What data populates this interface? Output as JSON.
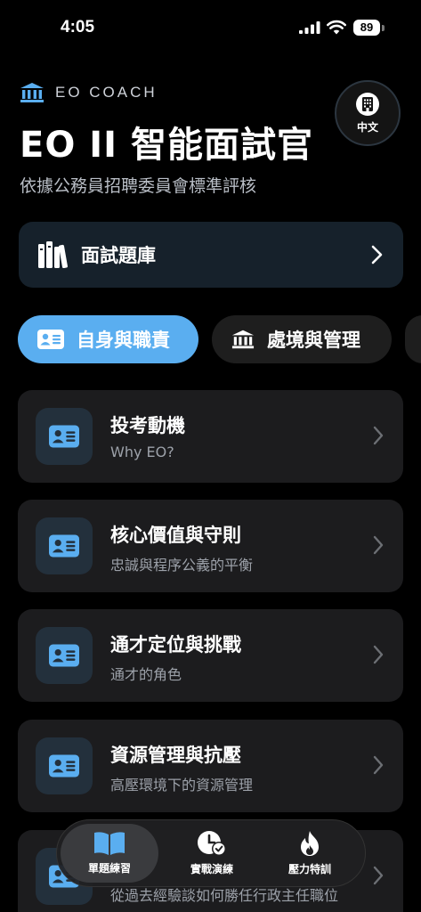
{
  "status_bar": {
    "time": "4:05",
    "battery": "89"
  },
  "header": {
    "brand": "EO COACH",
    "title": "EO II 智能面試官",
    "subtitle": "依據公務員招聘委員會標準評核",
    "lang_label": "中文"
  },
  "question_bank": {
    "label": "面試題庫"
  },
  "tabs": [
    {
      "label": "自身與職責"
    },
    {
      "label": "處境與管理"
    }
  ],
  "cards": [
    {
      "title": "投考動機",
      "subtitle": "Why EO?"
    },
    {
      "title": "核心價值與守則",
      "subtitle": "忠誠與程序公義的平衡"
    },
    {
      "title": "通才定位與挑戰",
      "subtitle": "通才的角色"
    },
    {
      "title": "資源管理與抗壓",
      "subtitle": "高壓環境下的資源管理"
    },
    {
      "title": "",
      "subtitle": "從過去經驗談如何勝任行政主任職位"
    }
  ],
  "nav": [
    {
      "label": "單題練習"
    },
    {
      "label": "實戰演練"
    },
    {
      "label": "壓力特訓"
    }
  ],
  "colors": {
    "accent": "#5aaef0",
    "background": "#000000",
    "card": "#1c1c1e"
  }
}
